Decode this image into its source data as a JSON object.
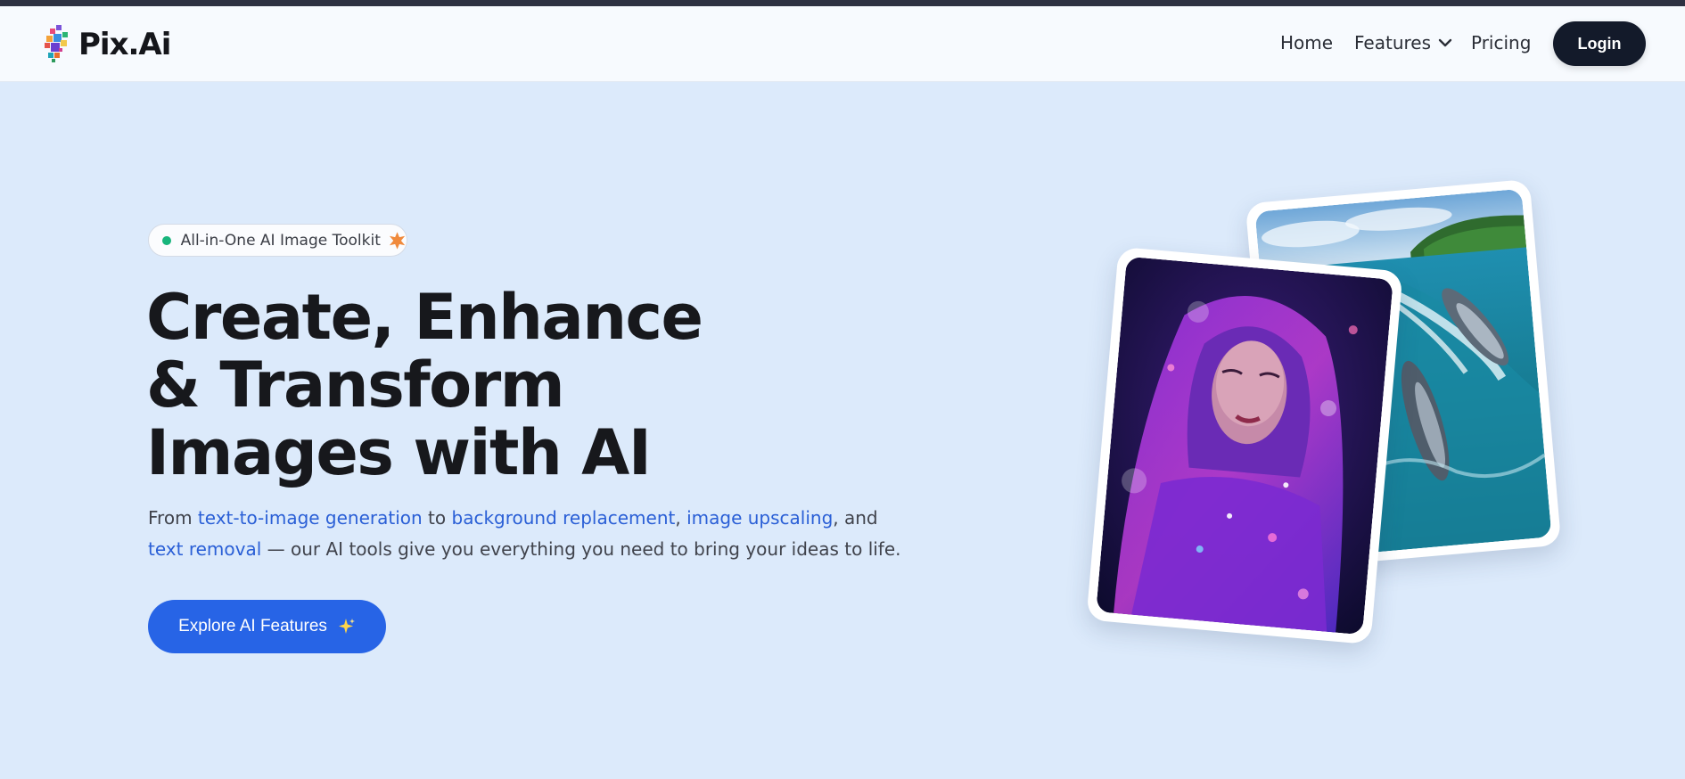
{
  "brand": {
    "name": "Pix.Ai",
    "logo_icon": "pixai-logo-icon"
  },
  "nav": {
    "home": "Home",
    "features": "Features",
    "pricing": "Pricing",
    "login": "Login"
  },
  "hero": {
    "badge": "All-in-One AI Image Toolkit",
    "title_lines": [
      "Create, Enhance",
      "& Transform",
      "Images with AI"
    ],
    "desc": {
      "t1": "From ",
      "l1": "text-to-image generation",
      "t2": " to ",
      "l2": "background replacement",
      "t3": ", ",
      "l3": "image upscaling",
      "t4": ", and",
      "l4": "text removal",
      "t5": " — our AI tools give you everything you need to bring your ideas to life."
    },
    "cta": "Explore AI Features"
  },
  "colors": {
    "background": "#dceafb",
    "accent": "#2764e6",
    "link": "#2a5fd6",
    "dark": "#131a2a",
    "badge_dot": "#18b57c"
  },
  "images": [
    {
      "name": "dolphins-ocean-image",
      "icon": "photo"
    },
    {
      "name": "woman-neon-portrait-image",
      "icon": "photo"
    }
  ]
}
